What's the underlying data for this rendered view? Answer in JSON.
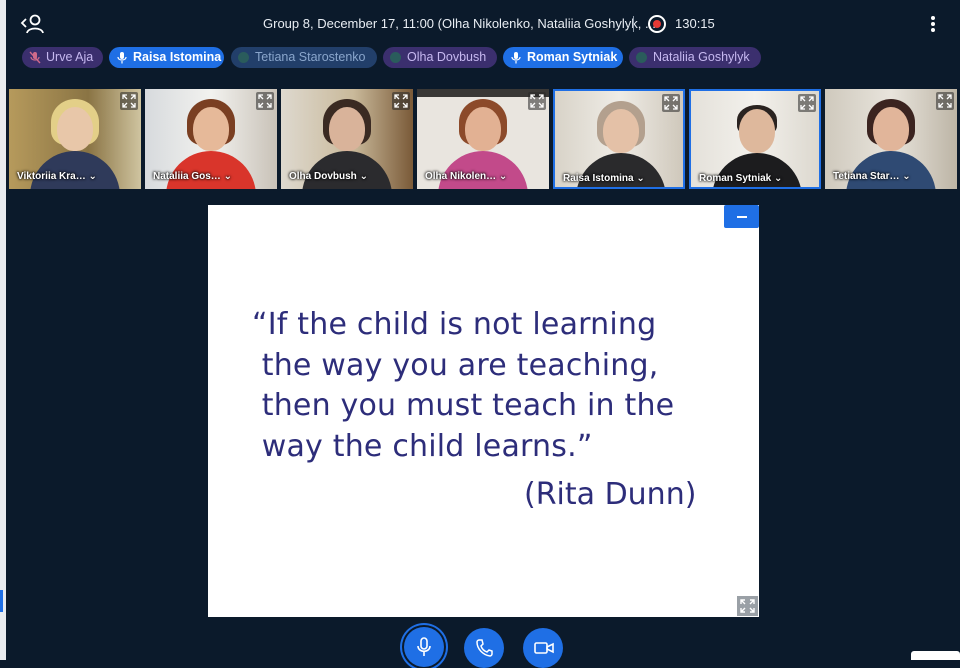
{
  "header": {
    "title": "Group 8, December 17, 11:00 (Olha Nikolenko, Nataliia Goshylyk, ...",
    "timer": "130:15",
    "recording": true
  },
  "talkers": [
    {
      "name": "Urve Aja",
      "state": "muted",
      "style": "idle-purple"
    },
    {
      "name": "Raisa Istomina",
      "state": "talking",
      "style": "active"
    },
    {
      "name": "Tetiana Starostenko",
      "state": "idle",
      "style": "idle-blue"
    },
    {
      "name": "Olha Dovbush",
      "state": "idle",
      "style": "idle-purple"
    },
    {
      "name": "Roman Sytniak",
      "state": "talking",
      "style": "active"
    },
    {
      "name": "Nataliia Goshylyk",
      "state": "idle",
      "style": "idle-purple"
    }
  ],
  "videos": [
    {
      "label": "Viktoriia Kra…"
    },
    {
      "label": "Nataliia Gos…"
    },
    {
      "label": "Olha Dovbush"
    },
    {
      "label": "Olha Nikolen…"
    },
    {
      "label": "Raisa Istomina"
    },
    {
      "label": "Roman Sytniak"
    },
    {
      "label": "Tetiana Star…"
    }
  ],
  "slide": {
    "quote": "“If the child is not learning\n the way you are teaching,\n then you must teach in the\n way the child learns.”",
    "author": "(Rita Dunn)"
  },
  "colors": {
    "background": "#0b1a2b",
    "accent": "#1f6fe5",
    "slide_text": "#2d2d7a",
    "recording": "#e53935"
  },
  "icons": {
    "user_list": "user-list-icon",
    "record": "record-icon",
    "options": "kebab-icon",
    "fullscreen": "fullscreen-icon",
    "minimize": "minimize-icon",
    "microphone": "microphone-icon",
    "phone": "phone-icon",
    "camera": "camera-icon"
  }
}
